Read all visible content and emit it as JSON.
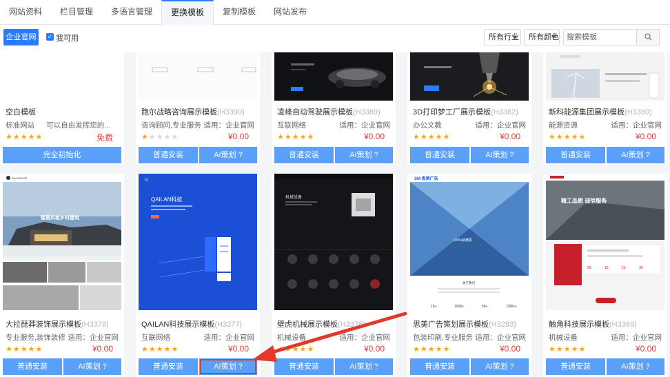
{
  "tabs": [
    "网站资料",
    "栏目管理",
    "多语言管理",
    "更换模板",
    "复制模板",
    "网站发布"
  ],
  "active_tab_index": 3,
  "toolbar": {
    "company_button": "企业官网",
    "my_available_label": "我可用",
    "my_available_checked": true,
    "industry_dropdown": "所有行业",
    "color_dropdown": "所有颜色",
    "search_placeholder": "搜索模板"
  },
  "accent_color": "#2a7cff",
  "button_color": "#5aa0f8",
  "price_color": "#e83a3a",
  "templates_row1": [
    {
      "name": "空白模板",
      "code": "",
      "industry": "标准网站",
      "fit": "可以自由发挥您的...",
      "stars": 5,
      "price": "免费",
      "button_full": "完全初始化"
    },
    {
      "name": "跑尔战略咨询展示模板",
      "code": "(H3390)",
      "industry": "咨询顾问,专业服务",
      "fit": "适用：企业官网",
      "stars": 1,
      "price": "¥0.00",
      "button_left": "普通安装",
      "button_right": "AI策划 ?"
    },
    {
      "name": "凌峰自动驾驶展示模板",
      "code": "(H3389)",
      "industry": "互联网络",
      "fit": "适用：企业官网",
      "stars": 5,
      "price": "¥0.00",
      "button_left": "普通安装",
      "button_right": "AI策划 ?"
    },
    {
      "name": "3D打印梦工厂展示模板",
      "code": "(H3382)",
      "industry": "办公文教",
      "fit": "适用：企业官网",
      "stars": 5,
      "price": "¥0.00",
      "button_left": "普通安装",
      "button_right": "AI策划 ?"
    },
    {
      "name": "新科能源集团展示模板",
      "code": "(H3380)",
      "industry": "能源资源",
      "fit": "适用：企业官网",
      "stars": 5,
      "price": "¥0.00",
      "button_left": "普通安装",
      "button_right": "AI策划 ?"
    }
  ],
  "templates_row2": [
    {
      "name": "大拉琵莽装饰展示模板",
      "code": "(H3378)",
      "industry": "专业服务,装饰装修",
      "fit": "适用：企业官网",
      "stars": 5,
      "price": "¥0.00",
      "button_left": "普通安装",
      "button_right": "AI策划 ?",
      "thumb_text": {
        "logo": "DALOSHOP",
        "banner": "智惠风格乡村建筑"
      }
    },
    {
      "name": "QAILAN科技展示模板",
      "code": "(H3377)",
      "industry": "互联网络",
      "fit": "适用：企业官网",
      "stars": 5,
      "price": "¥0.00",
      "button_left": "普通安装",
      "button_right": "AI策划 ?",
      "thumb_text": {
        "logo": "7Q",
        "banner": "QAILAN科技"
      }
    },
    {
      "name": "壁虎机械展示模板",
      "code": "(H3376)",
      "industry": "机械设备",
      "fit": "适用：企业官网",
      "stars": 5,
      "price": "¥0.00",
      "button_left": "普通安装",
      "button_right": "AI策划 ?",
      "thumb_text": {
        "banner": "机械设备"
      }
    },
    {
      "name": "思美广告策划展示模板",
      "code": "(H3283)",
      "industry": "包装印刷,专业服务",
      "fit": "适用：企业官网",
      "stars": 5,
      "price": "¥0.00",
      "button_left": "普通安装",
      "button_right": "AI策划 ?",
      "thumb_text": {
        "logo": "SM 思美广告",
        "banner": "100%就满意",
        "about": "关于我们",
        "stats": [
          "15+",
          "1000+",
          "50+",
          "2000+"
        ]
      }
    },
    {
      "name": "触角科技展示模板",
      "code": "(H3369)",
      "industry": "机械设备",
      "fit": "适用：企业官网",
      "stars": 5,
      "price": "¥0.00",
      "button_left": "普通安装",
      "button_right": "AI策划 ?",
      "thumb_text": {
        "banner": "精工品质  诚信服务",
        "stats": [
          "89",
          "10",
          "23",
          "36"
        ]
      }
    }
  ]
}
